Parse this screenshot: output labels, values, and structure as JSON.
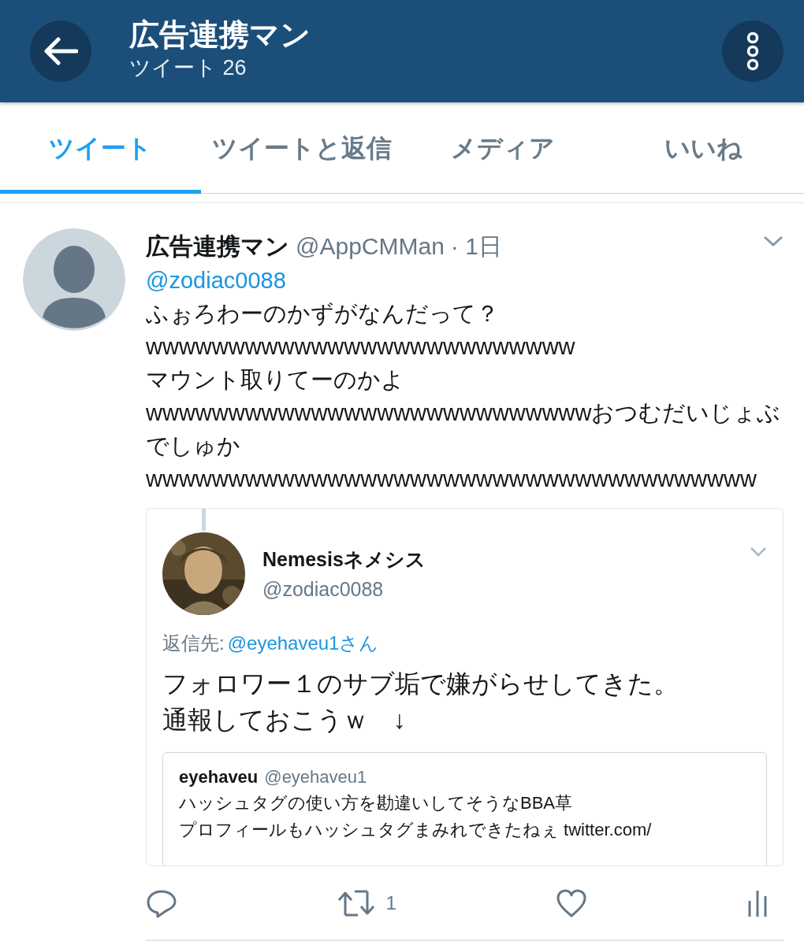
{
  "header": {
    "title": "広告連携マン",
    "subtitle": "ツイート 26"
  },
  "tabs": [
    {
      "label": "ツイート",
      "selected": true
    },
    {
      "label": "ツイートと返信",
      "selected": false
    },
    {
      "label": "メディア",
      "selected": false
    },
    {
      "label": "いいね",
      "selected": false
    }
  ],
  "tweet": {
    "name": "広告連携マン",
    "handle": "@AppCMMan",
    "time": "· 1日",
    "mention": "@zodiac0088",
    "lines": [
      "ふぉろわーのかずがなんだって？",
      "wwwwwwwwwwwwwwwwwwwwwwwwww",
      "マウント取りてーのかよ",
      "wwwwwwwwwwwwwwwwwwwwwwwwwwwおつむだいじょぶでしゅか",
      "wwwwwwwwwwwwwwwwwwwwwwwwwwwwwwwwwwwww"
    ],
    "quoted": {
      "name": "Nemesisネメシス",
      "handle": "@zodiac0088",
      "reply_label": "返信先:",
      "reply_to": "@eyehaveu1さん",
      "lines": [
        "フォロワー１のサブ垢で嫌がらせしてきた。",
        "通報しておこうｗ　↓"
      ],
      "quoted": {
        "name": "eyehaveu",
        "handle": "@eyehaveu1",
        "lines": [
          "ハッシュタグの使い方を勘違いしてそうなBBA草",
          "プロフィールもハッシュタグまみれできたねぇ twitter.com/"
        ]
      }
    },
    "retweets": "1"
  }
}
